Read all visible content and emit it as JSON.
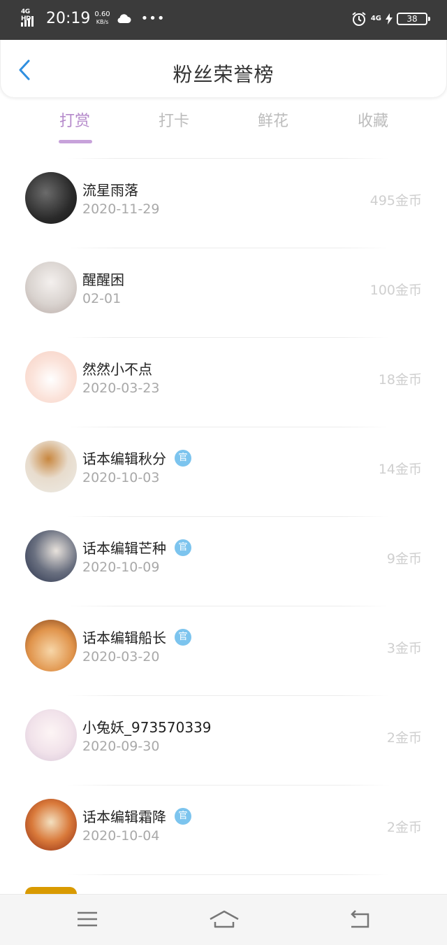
{
  "status_bar": {
    "network": "4G HD",
    "time": "20:19",
    "speed_value": "0.60",
    "speed_unit": "KB/s",
    "mobile": "4G",
    "battery": "38"
  },
  "header": {
    "title": "粉丝荣誉榜"
  },
  "tabs": [
    {
      "label": "打赏",
      "active": true
    },
    {
      "label": "打卡",
      "active": false
    },
    {
      "label": "鲜花",
      "active": false
    },
    {
      "label": "收藏",
      "active": false
    }
  ],
  "official_badge": "官",
  "rows": [
    {
      "name": "流星雨落",
      "date": "2020-11-29",
      "amount": "495金币"
    },
    {
      "name": "醒醒困",
      "date": "02-01",
      "amount": "100金币"
    },
    {
      "name": "然然小不点",
      "date": "2020-03-23",
      "amount": "18金币"
    },
    {
      "name": "话本编辑秋分",
      "date": "2020-10-03",
      "amount": "14金币"
    },
    {
      "name": "话本编辑芒种",
      "date": "2020-10-09",
      "amount": "9金币"
    },
    {
      "name": "话本编辑船长",
      "date": "2020-03-20",
      "amount": "3金币"
    },
    {
      "name": "小兔妖_973570339",
      "date": "2020-09-30",
      "amount": "2金币"
    },
    {
      "name": "话本编辑霜降",
      "date": "2020-10-04",
      "amount": "2金币"
    }
  ],
  "colors": {
    "accent": "#b58acb",
    "official": "#7cc4ee",
    "back_arrow": "#2f8fe0",
    "status_bar": "#3b3b3b"
  }
}
